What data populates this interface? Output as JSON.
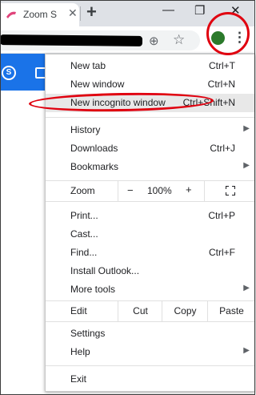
{
  "tab": {
    "title": "Zoom S",
    "close": "✕"
  },
  "window": {
    "minimize": "—",
    "restore": "❐",
    "close": "✕",
    "new_tab": "+"
  },
  "menu": {
    "group1": [
      {
        "label": "New tab",
        "shortcut": "Ctrl+T"
      },
      {
        "label": "New window",
        "shortcut": "Ctrl+N"
      },
      {
        "label": "New incognito window",
        "shortcut": "Ctrl+Shift+N"
      }
    ],
    "group2": [
      {
        "label": "History",
        "submenu": "▶"
      },
      {
        "label": "Downloads",
        "shortcut": "Ctrl+J"
      },
      {
        "label": "Bookmarks",
        "submenu": "▶"
      }
    ],
    "zoom": {
      "label": "Zoom",
      "minus": "−",
      "value": "100%",
      "plus": "+"
    },
    "group3": [
      {
        "label": "Print...",
        "shortcut": "Ctrl+P"
      },
      {
        "label": "Cast..."
      },
      {
        "label": "Find...",
        "shortcut": "Ctrl+F"
      },
      {
        "label": "Install Outlook..."
      },
      {
        "label": "More tools",
        "submenu": "▶"
      }
    ],
    "edit": {
      "label": "Edit",
      "cut": "Cut",
      "copy": "Copy",
      "paste": "Paste"
    },
    "group4": [
      {
        "label": "Settings"
      },
      {
        "label": "Help",
        "submenu": "▶"
      }
    ],
    "exit": {
      "label": "Exit"
    }
  },
  "page": {
    "skype_glyph": "S"
  },
  "colors": {
    "annotation": "#e0000f",
    "page_accent": "#1a73e8",
    "avatar": "#2b7a2b"
  }
}
